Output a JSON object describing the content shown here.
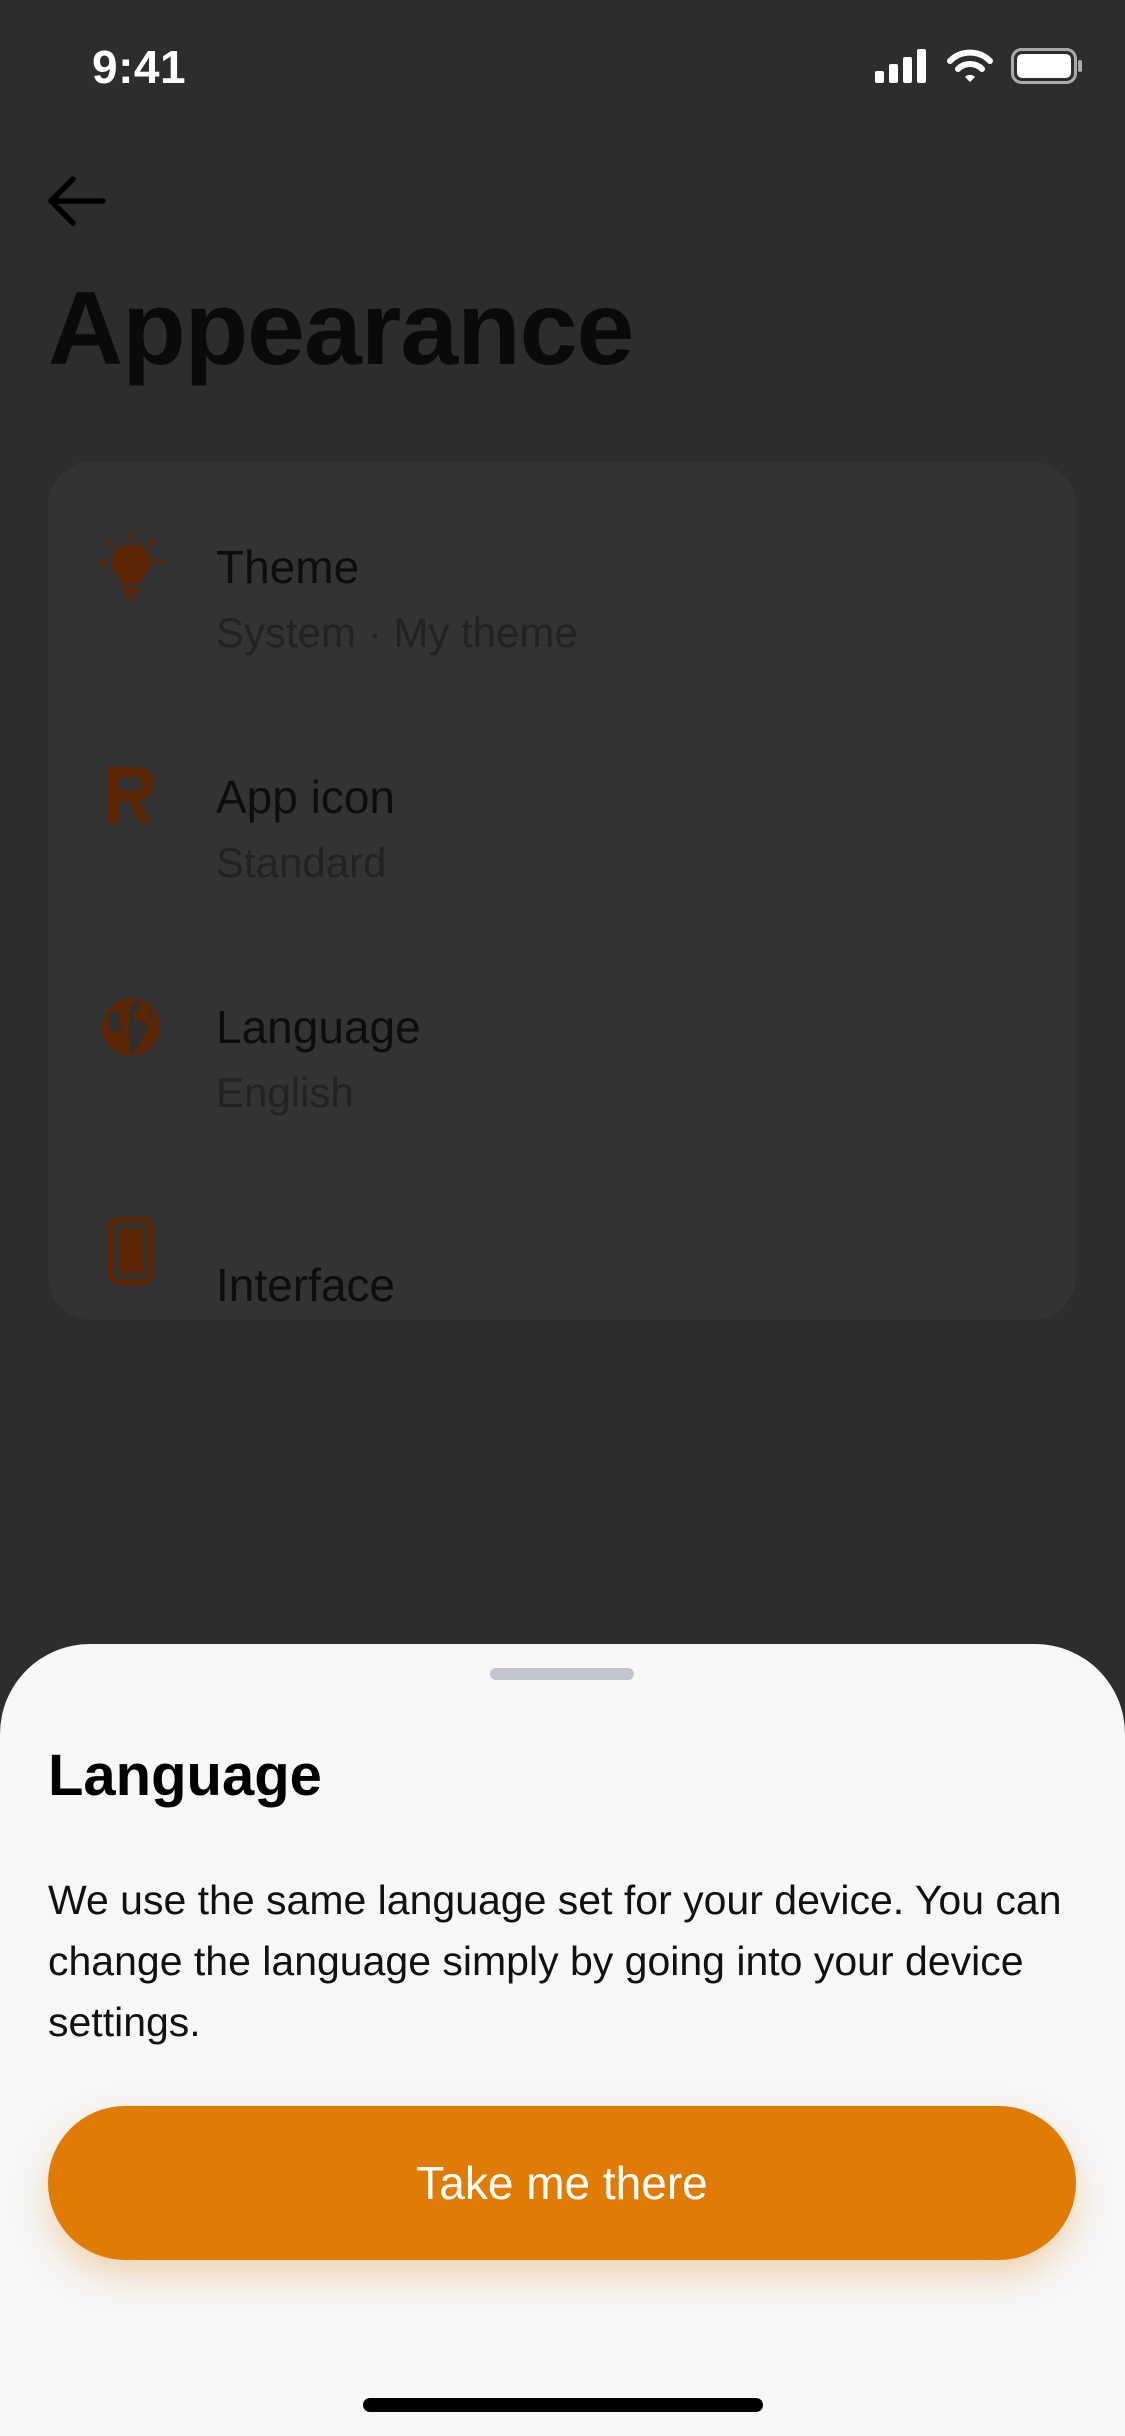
{
  "status_bar": {
    "time": "9:41",
    "icons": [
      "cellular-signal-icon",
      "wifi-icon",
      "battery-icon"
    ]
  },
  "header": {
    "back_icon": "arrow-left-icon",
    "title": "Appearance"
  },
  "settings": [
    {
      "icon": "lightbulb-icon",
      "title": "Theme",
      "subtitle": "System · My theme"
    },
    {
      "icon": "app-r-logo-icon",
      "title": "App icon",
      "subtitle": "Standard"
    },
    {
      "icon": "globe-icon",
      "title": "Language",
      "subtitle": "English"
    },
    {
      "icon": "phone-icon",
      "title": "Interface"
    }
  ],
  "sheet": {
    "title": "Language",
    "description": "We use the same language set for your device. You can change the language simply by going into your device settings.",
    "button_label": "Take me there"
  },
  "colors": {
    "accent": "#e07b03",
    "icon_dim": "#5a2604",
    "overlay_bg": "#2d2d2d",
    "sheet_bg": "#f7f7f7"
  }
}
